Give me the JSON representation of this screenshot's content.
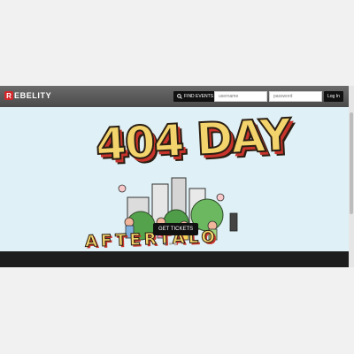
{
  "brand": {
    "logo_letter": "R",
    "name": "EBELITY",
    "accent": "#d3262b"
  },
  "navbar": {
    "find_events_label": "FIND EVENTS",
    "username_placeholder": "username",
    "password_placeholder": "password",
    "login_label": "Log In"
  },
  "hero": {
    "title": "404 DAY",
    "subtitle": "AFTERTALO",
    "cta_label": "GET TICKETS",
    "slides": 3,
    "active_slide": 1
  },
  "colors": {
    "hero_bg": "#dff1f6",
    "title_fill": "#f3d36b",
    "title_shadow": "#c8342b",
    "navbar": "#4f4f4f"
  },
  "icons": {
    "find_events": "search-icon"
  }
}
